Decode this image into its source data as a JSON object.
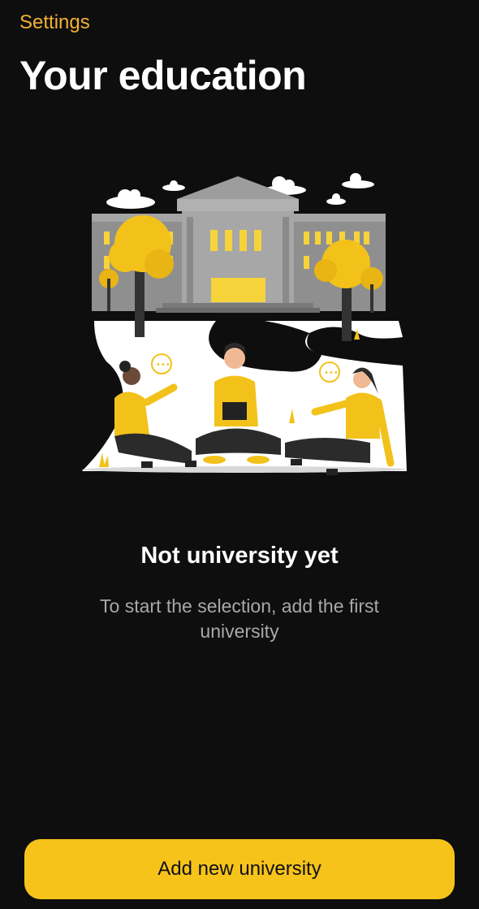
{
  "nav": {
    "back_label": "Settings"
  },
  "header": {
    "title": "Your education"
  },
  "empty_state": {
    "illustration": "students-at-university-illustration",
    "title": "Not university yet",
    "subtitle": "To start the selection, add the first university"
  },
  "actions": {
    "add_label": "Add new university"
  },
  "colors": {
    "background": "#0e0e0e",
    "accent": "#f6c31b",
    "back_link": "#f2b233",
    "subtitle": "#a8a8a8"
  }
}
